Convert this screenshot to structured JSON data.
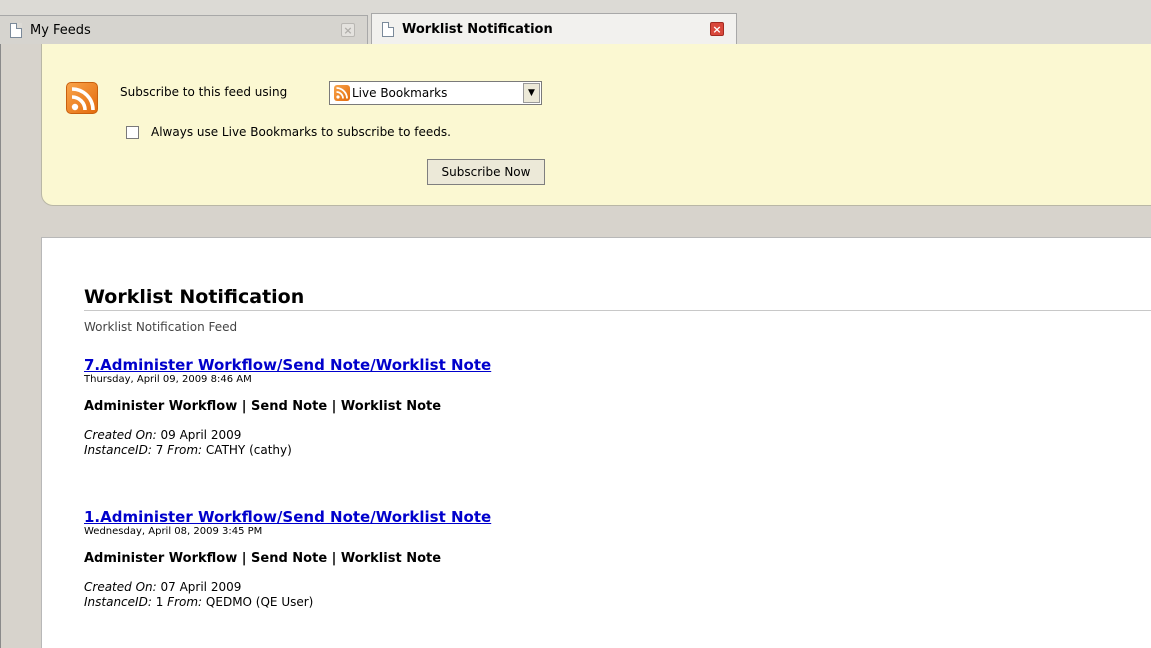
{
  "tabs": [
    {
      "label": "My Feeds",
      "active": false
    },
    {
      "label": "Worklist Notification",
      "active": true
    }
  ],
  "subscribe": {
    "label": "Subscribe to this feed using",
    "selected": "Live Bookmarks",
    "checkbox_label": "Always use Live Bookmarks to subscribe to feeds.",
    "checked": false,
    "button_label": "Subscribe Now"
  },
  "feed": {
    "title": "Worklist Notification",
    "subtitle": "Worklist Notification Feed",
    "entries": [
      {
        "title": "7.Administer Workflow/Send Note/Worklist Note",
        "date": "Thursday, April 09, 2009 8:46 AM",
        "summary": "Administer Workflow | Send Note | Worklist Note",
        "created_label": "Created On:",
        "created_value": "09 April 2009",
        "instance_label": "InstanceID:",
        "instance_value": "7",
        "from_label": "From:",
        "from_value": "CATHY (cathy)"
      },
      {
        "title": "1.Administer Workflow/Send Note/Worklist Note",
        "date": "Wednesday, April 08, 2009 3:45 PM",
        "summary": "Administer Workflow | Send Note | Worklist Note",
        "created_label": "Created On:",
        "created_value": "07 April 2009",
        "instance_label": "InstanceID:",
        "instance_value": "1",
        "from_label": "From:",
        "from_value": "QEDMO (QE User)"
      }
    ]
  },
  "colors": {
    "link": "#0000cc",
    "subscribe_bg": "#fbf8d2",
    "chrome_bg": "#d7d3cc",
    "close_active": "#d9483b"
  },
  "icons": [
    "page-icon",
    "close-icon",
    "rss-icon",
    "chevron-down-icon"
  ]
}
